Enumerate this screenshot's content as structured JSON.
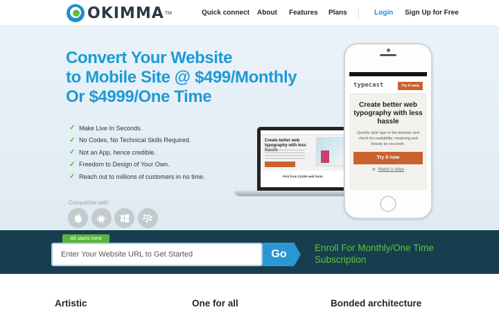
{
  "brand": {
    "name": "OKIMMA",
    "tm": "TM"
  },
  "nav": {
    "quick_connect": "Quick connect",
    "about": "About",
    "features": "Features",
    "plans": "Plans",
    "login": "Login",
    "signup": "Sign Up for Free"
  },
  "hero": {
    "headline_lines": [
      "Convert Your Website",
      "to Mobile Site @ $499/Monthly",
      "Or $4999/One Time"
    ],
    "features": [
      "Make Live In Seconds.",
      "No Codes, No Technical Skills Required.",
      "Not an App, hence credible.",
      "Freedom to Design of Your Own.",
      "Reach out to millions of customers in no time."
    ],
    "compatible_label": "Compatible with:",
    "os_icons": [
      "apple-icon",
      "android-icon",
      "windows-icon",
      "blackberry-icon"
    ]
  },
  "devices": {
    "laptop": {
      "title": "Create better web typography with less hassle",
      "footer": "Pick from 23,000 web fonts"
    },
    "phone": {
      "brand": "typecast",
      "try_button": "Try it now",
      "title": "Create better web typography with less hassle",
      "description": "Quickly style type in the browser and check for readability, rendering and beauty as you work.",
      "cta": "Try it now",
      "video_prefix": "or",
      "video_link": "Watch a video"
    }
  },
  "signup": {
    "tag": "All starts here",
    "placeholder": "Enter Your Website URL to Get Started",
    "go_label": "Go",
    "enroll_text": "Enroll For Monthly/One Time Subscription"
  },
  "columns": [
    "Artistic",
    "One for all",
    "Bonded architecture"
  ],
  "colors": {
    "accent_blue": "#1e9ad6",
    "accent_green": "#5cb43a",
    "band": "#173e4f",
    "orange": "#c9622c"
  }
}
